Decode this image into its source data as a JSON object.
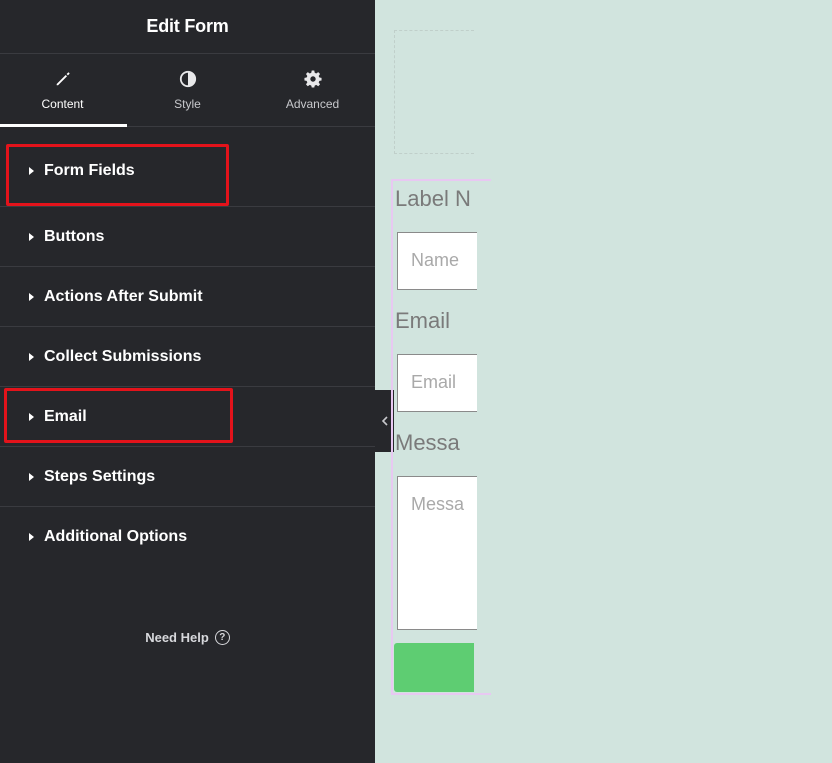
{
  "panel": {
    "title": "Edit Form",
    "tabs": [
      {
        "label": "Content",
        "icon": "pencil-icon",
        "active": true
      },
      {
        "label": "Style",
        "icon": "half-circle-icon",
        "active": false
      },
      {
        "label": "Advanced",
        "icon": "gear-icon",
        "active": false
      }
    ],
    "sections": [
      {
        "label": "Form Fields",
        "highlighted": true
      },
      {
        "label": "Buttons",
        "highlighted": false
      },
      {
        "label": "Actions After Submit",
        "highlighted": false
      },
      {
        "label": "Collect Submissions",
        "highlighted": false
      },
      {
        "label": "Email",
        "highlighted": true
      },
      {
        "label": "Steps Settings",
        "highlighted": false
      },
      {
        "label": "Additional Options",
        "highlighted": false
      }
    ],
    "help_label": "Need Help",
    "help_icon": "question-circle-icon",
    "collapse_icon": "chevron-left-icon"
  },
  "preview": {
    "fields": [
      {
        "label": "Label N",
        "placeholder": "Name"
      },
      {
        "label": "Email",
        "placeholder": "Email"
      },
      {
        "label": "Messa",
        "placeholder": "Messa"
      }
    ]
  },
  "colors": {
    "panel_bg": "#26272b",
    "canvas_bg": "#d1e4de",
    "highlight": "#e3131b",
    "submit_button": "#5ecd72",
    "widget_outline": "#e8c8f2"
  }
}
